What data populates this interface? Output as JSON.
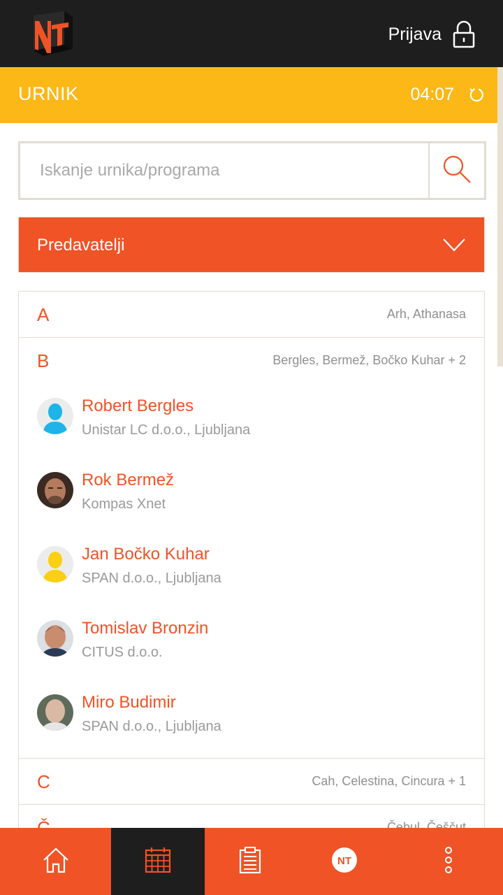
{
  "header": {
    "login_label": "Prijava",
    "logo_icon": "nt-logo-icon",
    "lock_icon": "lock-icon"
  },
  "titlebar": {
    "title": "URNIK",
    "time": "04:07",
    "refresh_icon": "refresh-icon"
  },
  "search": {
    "placeholder": "Iskanje urnika/programa",
    "value": "",
    "icon": "search-icon"
  },
  "filter": {
    "selected": "Predavatelji",
    "icon": "chevron-down-icon"
  },
  "groups": [
    {
      "letter": "A",
      "summary": "Arh, Athanasa"
    },
    {
      "letter": "B",
      "summary": "Bergles, Bermež, Bočko Kuhar + 2"
    },
    {
      "letter": "C",
      "summary": "Cah, Celestina, Cincura + 1"
    },
    {
      "letter": "Č",
      "summary": "Čebul, Češčut"
    }
  ],
  "people": [
    {
      "name": "Robert Bergles",
      "company": "Unistar LC d.o.o., Ljubljana",
      "avatar": "placeholder-blue"
    },
    {
      "name": "Rok Bermež",
      "company": "Kompas Xnet",
      "avatar": "photo"
    },
    {
      "name": "Jan Bočko Kuhar",
      "company": "SPAN d.o.o., Ljubljana",
      "avatar": "placeholder-yellow"
    },
    {
      "name": "Tomislav Bronzin",
      "company": "CITUS d.o.o.",
      "avatar": "photo"
    },
    {
      "name": "Miro Budimir",
      "company": "SPAN d.o.o., Ljubljana",
      "avatar": "photo"
    }
  ],
  "nav": [
    {
      "name": "home-icon",
      "active": false
    },
    {
      "name": "calendar-icon",
      "active": true
    },
    {
      "name": "clipboard-icon",
      "active": false
    },
    {
      "name": "nt-badge-icon",
      "active": false
    },
    {
      "name": "more-vertical-icon",
      "active": false
    }
  ],
  "colors": {
    "accent": "#ef5326",
    "yellow": "#fbb817",
    "dark": "#1e1e1e"
  }
}
